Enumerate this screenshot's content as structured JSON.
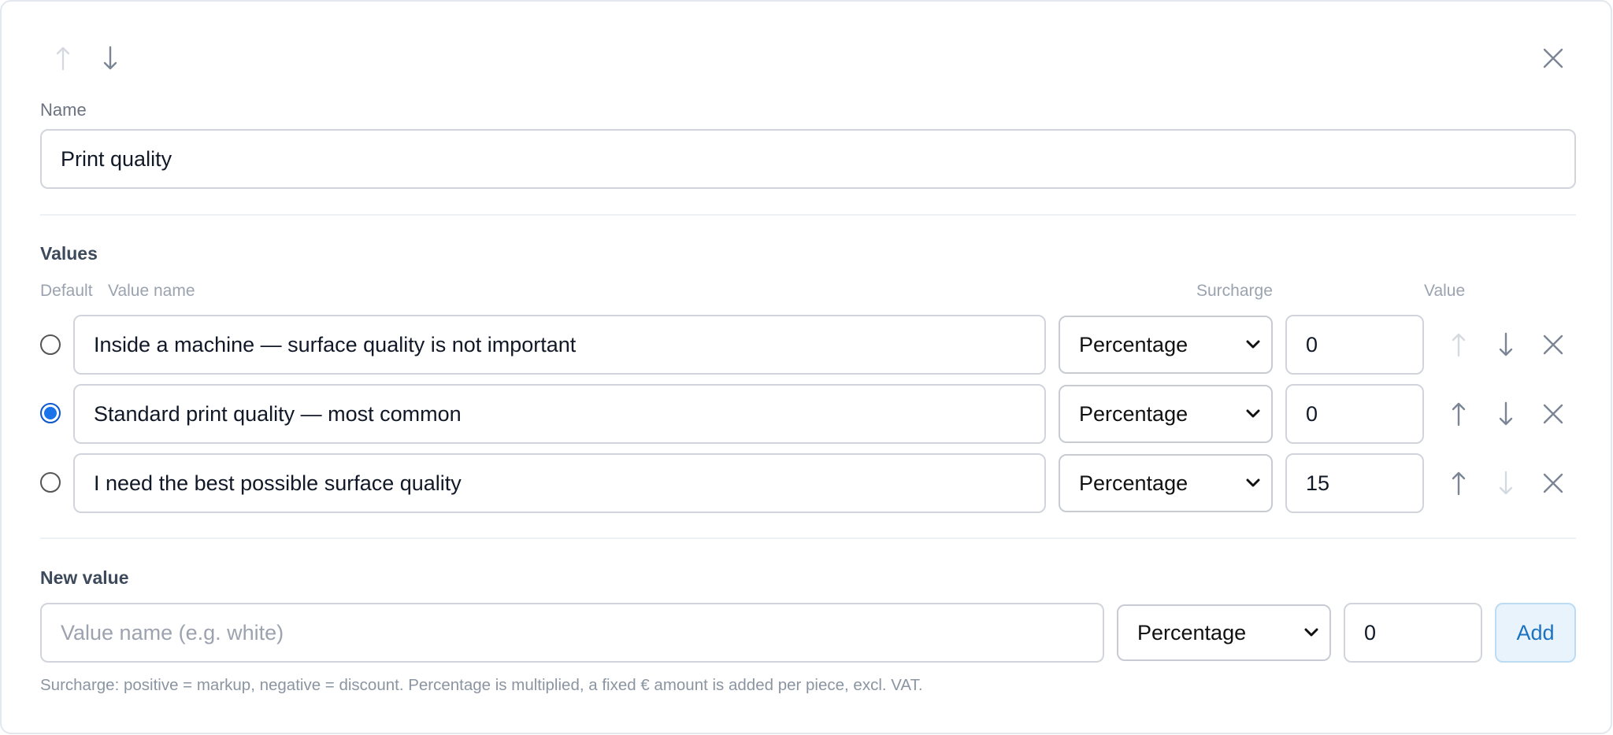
{
  "header": {
    "move_up_icon": "arrow-up-icon",
    "move_down_icon": "arrow-down-icon",
    "close_icon": "close-icon"
  },
  "name_field": {
    "label": "Name",
    "value": "Print quality"
  },
  "values_section": {
    "title": "Values",
    "columns": {
      "default": "Default",
      "value_name": "Value name",
      "surcharge": "Surcharge",
      "value": "Value"
    },
    "rows": [
      {
        "default": false,
        "name": "Inside a machine — surface quality is not important",
        "surcharge_type": "Percentage",
        "value": "0",
        "up_enabled": false,
        "down_enabled": true
      },
      {
        "default": true,
        "name": "Standard print quality — most common",
        "surcharge_type": "Percentage",
        "value": "0",
        "up_enabled": true,
        "down_enabled": true
      },
      {
        "default": false,
        "name": "I need the best possible surface quality",
        "surcharge_type": "Percentage",
        "value": "15",
        "up_enabled": true,
        "down_enabled": false
      }
    ]
  },
  "new_value": {
    "title": "New value",
    "name_placeholder": "Value name (e.g. white)",
    "name_value": "",
    "surcharge_type": "Percentage",
    "value": "0",
    "add_label": "Add",
    "hint": "Surcharge: positive = markup, negative = discount. Percentage is multiplied, a fixed € amount is added per piece, excl. VAT."
  },
  "colors": {
    "accent": "#1a73e8",
    "add_button_bg": "#e8f3fc",
    "add_button_text": "#1b72c0",
    "icon_enabled": "#7b8594",
    "icon_disabled": "#d5dae1"
  }
}
